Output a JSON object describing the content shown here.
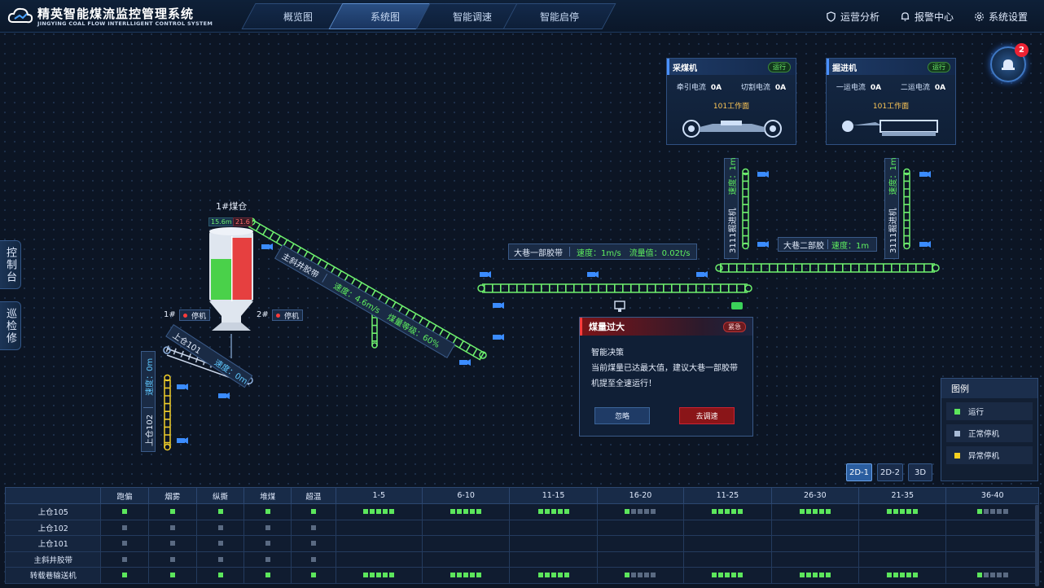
{
  "app": {
    "title": "精英智能煤流监控管理系统",
    "subtitle": "JINGYING COAL FLOW INTERLLIGENT CONTROL SYSTEM"
  },
  "nav": {
    "tabs": [
      "概览图",
      "系统图",
      "智能调速",
      "智能启停"
    ],
    "active_tab": "系统图",
    "right": [
      "运营分析",
      "报警中心",
      "系统设置"
    ]
  },
  "side_tabs": [
    "控制台",
    "巡检修"
  ],
  "alarm_count": "2",
  "shearer": {
    "title": "采煤机",
    "status": "运行",
    "label1": "牵引电流",
    "value1": "0A",
    "label2": "切割电流",
    "value2": "0A",
    "face": "101工作面"
  },
  "roadheader": {
    "title": "掘进机",
    "status": "运行",
    "label1": "一运电流",
    "value1": "0A",
    "label2": "二运电流",
    "value2": "0A",
    "face": "101工作面"
  },
  "silo": {
    "title": "1#煤仓",
    "left_value": "15.6m",
    "right_value": "21.6",
    "gate1": "1#",
    "gate1_status": "停机",
    "gate2": "2#",
    "gate2_status": "停机"
  },
  "conveyors": {
    "main_incline": {
      "name": "主斜井胶带",
      "speed": "速度：4.6m/s",
      "level": "煤量等级：60%"
    },
    "bin101": {
      "name": "上仓101",
      "speed": "速度：0m"
    },
    "bin102": {
      "name": "上仓102",
      "speed": "速度：0m"
    },
    "lane1": {
      "name": "大巷一部胶带",
      "speed": "速度：1m/s",
      "flow": "流量值：0.02t/s"
    },
    "lane2": {
      "name": "大巷二部胶",
      "speed": "速度：1m"
    },
    "heading_a": {
      "name": "3111掘进机",
      "speed": "速度：1m"
    },
    "heading_b": {
      "name": "3111掘进机",
      "speed": "速度：1m"
    }
  },
  "popup": {
    "title": "煤量过大",
    "urgency": "紧急",
    "heading": "智能决策",
    "message": "当前煤量已达最大值，建议大巷一部胶带机提至全速运行！",
    "ignore": "忽略",
    "action": "去调速"
  },
  "legend": {
    "title": "图例",
    "items": [
      {
        "label": "运行",
        "color": "#5ce65c"
      },
      {
        "label": "正常停机",
        "color": "#a8bbd6"
      },
      {
        "label": "异常停机",
        "color": "#f5d020"
      }
    ]
  },
  "view_buttons": [
    "2D-1",
    "2D-2",
    "3D"
  ],
  "table": {
    "headers": [
      "",
      "跑偏",
      "烟雾",
      "纵撕",
      "堆煤",
      "超温",
      "1-5",
      "6-10",
      "11-15",
      "16-20",
      "11-25",
      "26-30",
      "21-35",
      "36-40"
    ],
    "rows": [
      {
        "name": "上仓105",
        "cells": [
          "g",
          "g",
          "g",
          "g",
          "g",
          "ggggg",
          "ggggg",
          "ggggg",
          "gssss",
          "ggggg",
          "ggggg",
          "ggggg",
          "gssss"
        ]
      },
      {
        "name": "上仓102",
        "cells": [
          "s",
          "s",
          "s",
          "s",
          "s",
          "",
          "",
          "",
          "",
          "",
          "",
          "",
          ""
        ]
      },
      {
        "name": "上仓101",
        "cells": [
          "s",
          "s",
          "s",
          "s",
          "s",
          "",
          "",
          "",
          "",
          "",
          "",
          "",
          ""
        ]
      },
      {
        "name": "主斜井胶带",
        "cells": [
          "s",
          "s",
          "s",
          "s",
          "s",
          "",
          "",
          "",
          "",
          "",
          "",
          "",
          ""
        ]
      },
      {
        "name": "转载巷输送机",
        "cells": [
          "g",
          "g",
          "g",
          "g",
          "g",
          "ggggg",
          "ggggg",
          "ggggg",
          "gssss",
          "ggggg",
          "ggggg",
          "ggggg",
          "gssss"
        ]
      }
    ]
  }
}
